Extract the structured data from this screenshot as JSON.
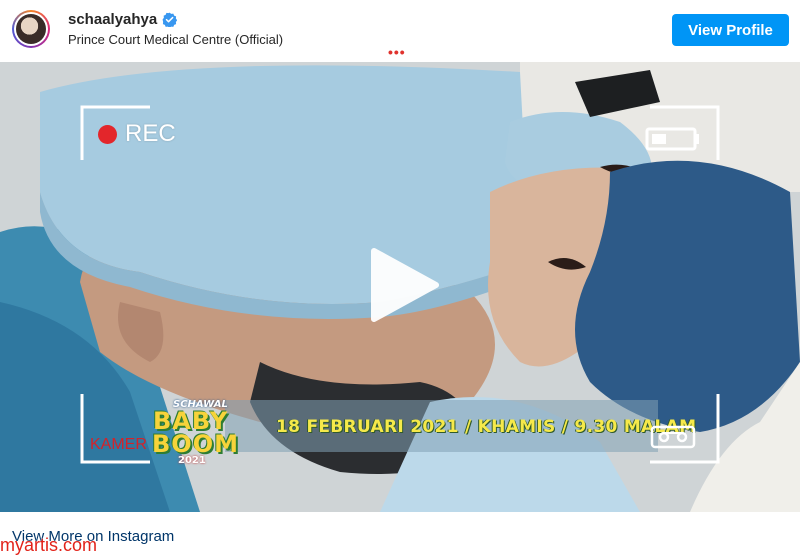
{
  "post": {
    "username": "schaalyahya",
    "verified_icon": "verified-badge-icon",
    "location": "Prince Court Medical Centre (Official)",
    "view_profile_label": "View Profile",
    "ad_indicator": "•••"
  },
  "media": {
    "rec_label": "REC",
    "kamera_label": "KAMER",
    "logo": {
      "top": "SCHAWAL",
      "line1": "BABY",
      "line2": "BOOM",
      "year": "2021"
    },
    "banner_text": "18 FEBRUARI 2021  /  KHAMIS  /  9.30 MALAM",
    "play_icon": "play-icon",
    "battery_icon": "battery-icon",
    "camera_icon": "cassette-icon"
  },
  "footer": {
    "view_more_label": "View More on Instagram"
  },
  "watermark": "myartis.com",
  "colors": {
    "button_blue": "#0095f6",
    "rec_red": "#e3262b",
    "banner_yellow": "#f6e94a",
    "link_navy": "#003569",
    "watermark_red": "#e2231a"
  }
}
